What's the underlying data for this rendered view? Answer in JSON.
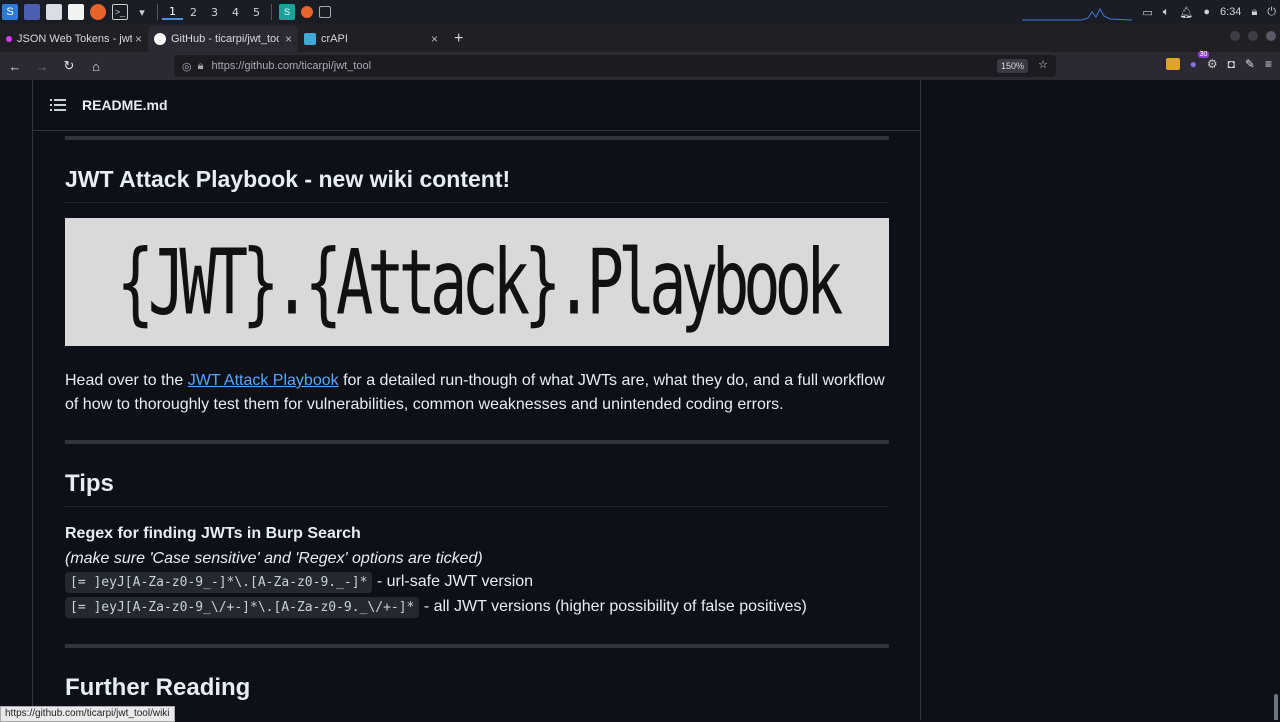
{
  "taskbar": {
    "workspaces": [
      "1",
      "2",
      "3",
      "4",
      "5"
    ],
    "active_workspace": "1",
    "clock": "6:34"
  },
  "browser": {
    "tabs": [
      {
        "title": "JSON Web Tokens - jwt.io",
        "icon": "jwt-favicon",
        "active": false
      },
      {
        "title": "GitHub - ticarpi/jwt_tool:",
        "icon": "github-icon",
        "active": true
      },
      {
        "title": "crAPI",
        "icon": "crapi-favicon",
        "active": false
      }
    ],
    "new_tab": "+",
    "url": "https://github.com/ticarpi/jwt_tool",
    "zoom": "150%",
    "extension_badge": "30",
    "status_url": "https://github.com/ticarpi/jwt_tool/wiki"
  },
  "readme": {
    "filename": "README.md",
    "playbook_heading": "JWT Attack Playbook - new wiki content!",
    "banner_text": "{JWT}.{Attack}.Playbook",
    "intro_before": "Head over to the ",
    "intro_link": "JWT Attack Playbook",
    "intro_after": " for a detailed run-though of what JWTs are, what they do, and a full workflow of how to thoroughly test them for vulnerabilities, common weaknesses and unintended coding errors.",
    "tips_heading": "Tips",
    "regex_title": "Regex for finding JWTs in Burp Search",
    "regex_note": "(make sure 'Case sensitive' and 'Regex' options are ticked)",
    "regex_1": "[= ]eyJ[A-Za-z0-9_-]*\\.[A-Za-z0-9._-]*",
    "regex_1_desc": " - url-safe JWT version",
    "regex_2": "[= ]eyJ[A-Za-z0-9_\\/+-]*\\.[A-Za-z0-9._\\/+-]*",
    "regex_2_desc": " - all JWT versions (higher possibility of false positives)",
    "further_heading": "Further Reading"
  },
  "colors": {
    "page_bg": "#0d1117",
    "link": "#58a6ff",
    "text": "#e6edf3",
    "banner_bg": "#d9d9d9"
  }
}
